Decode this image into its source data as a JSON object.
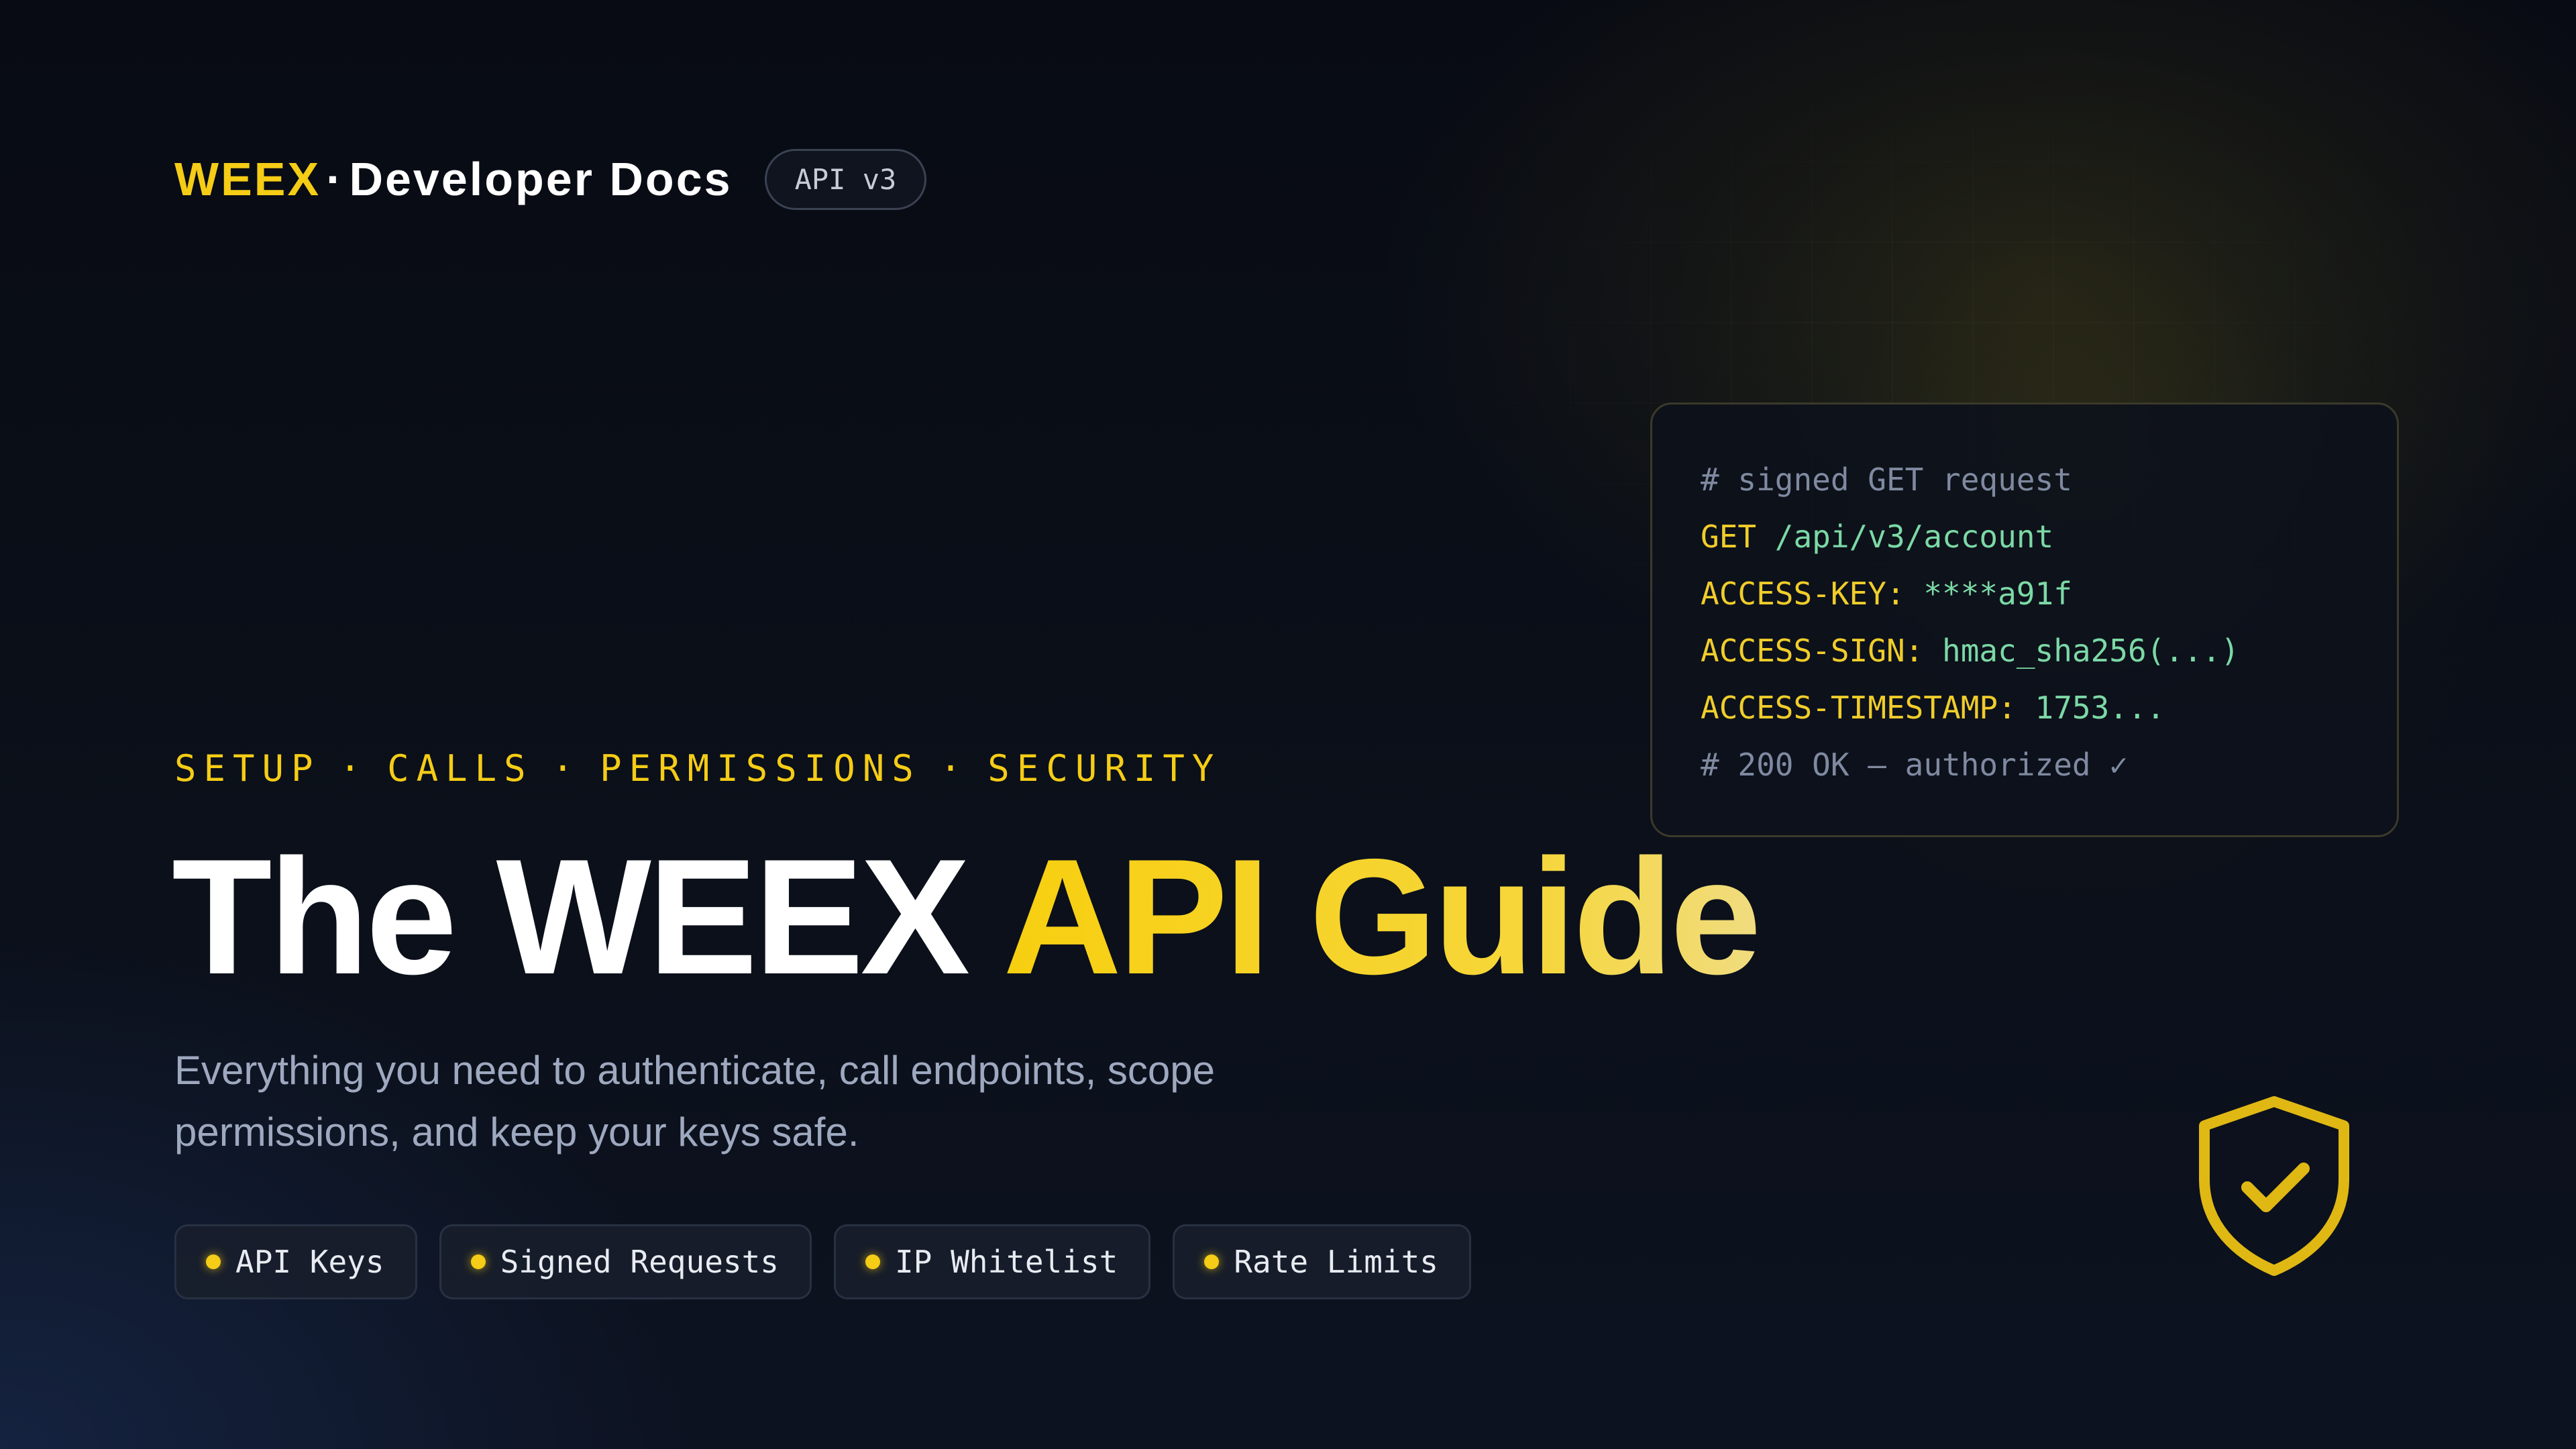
{
  "header": {
    "brand": "WEEX",
    "separator": "·",
    "product": "Developer Docs",
    "version_badge": "API v3"
  },
  "code_card": {
    "lines": [
      {
        "key": "# signed GET request",
        "value": "",
        "kind": "comment"
      },
      {
        "key": "GET",
        "value": " /api/v3/account",
        "kind": "kv"
      },
      {
        "key": "ACCESS-KEY:",
        "value": " ****a91f",
        "kind": "kv"
      },
      {
        "key": "ACCESS-SIGN:",
        "value": " hmac_sha256(...)",
        "kind": "kv"
      },
      {
        "key": "ACCESS-TIMESTAMP:",
        "value": " 1753...",
        "kind": "kv"
      },
      {
        "key": "# 200 OK — authorized ✓",
        "value": "",
        "kind": "comment"
      }
    ]
  },
  "tagline": {
    "items": [
      "SETUP",
      "CALLS",
      "PERMISSIONS",
      "SECURITY"
    ],
    "separator": "·"
  },
  "title": {
    "part1": "The WEEX ",
    "part2": "API Guide"
  },
  "subtitle": "Everything you need to authenticate, call endpoints, scope permissions, and keep your keys safe.",
  "chips": [
    {
      "label": "API Keys"
    },
    {
      "label": "Signed Requests"
    },
    {
      "label": "IP Whitelist"
    },
    {
      "label": "Rate Limits"
    }
  ],
  "decor": {
    "shield_icon": "shield-check-icon"
  },
  "colors": {
    "accent": "#f5cc16",
    "background": "#0a0e17",
    "code_value": "#7cd9a6",
    "code_comment": "#7f8aa1",
    "subtitle": "#9ea9c0"
  }
}
